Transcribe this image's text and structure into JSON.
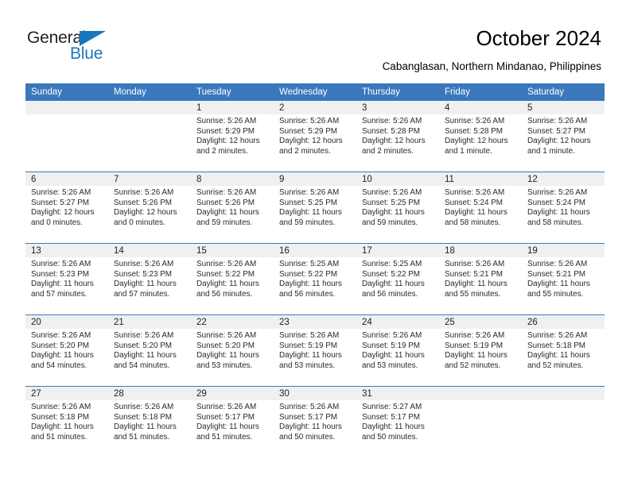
{
  "brand": {
    "name_top": "General",
    "name_bottom": "Blue",
    "accent_color": "#1878be",
    "triangle_icon": "triangle-icon"
  },
  "header": {
    "title": "October 2024",
    "subtitle": "Cabanglasan, Northern Mindanao, Philippines"
  },
  "calendar": {
    "header_color": "#3a78bd",
    "daynum_band_color": "#f0f0f0",
    "weekdays": [
      "Sunday",
      "Monday",
      "Tuesday",
      "Wednesday",
      "Thursday",
      "Friday",
      "Saturday"
    ],
    "weeks": [
      [
        {
          "day": "",
          "sunrise": "",
          "sunset": "",
          "daylight": ""
        },
        {
          "day": "",
          "sunrise": "",
          "sunset": "",
          "daylight": ""
        },
        {
          "day": "1",
          "sunrise": "Sunrise: 5:26 AM",
          "sunset": "Sunset: 5:29 PM",
          "daylight": "Daylight: 12 hours and 2 minutes."
        },
        {
          "day": "2",
          "sunrise": "Sunrise: 5:26 AM",
          "sunset": "Sunset: 5:29 PM",
          "daylight": "Daylight: 12 hours and 2 minutes."
        },
        {
          "day": "3",
          "sunrise": "Sunrise: 5:26 AM",
          "sunset": "Sunset: 5:28 PM",
          "daylight": "Daylight: 12 hours and 2 minutes."
        },
        {
          "day": "4",
          "sunrise": "Sunrise: 5:26 AM",
          "sunset": "Sunset: 5:28 PM",
          "daylight": "Daylight: 12 hours and 1 minute."
        },
        {
          "day": "5",
          "sunrise": "Sunrise: 5:26 AM",
          "sunset": "Sunset: 5:27 PM",
          "daylight": "Daylight: 12 hours and 1 minute."
        }
      ],
      [
        {
          "day": "6",
          "sunrise": "Sunrise: 5:26 AM",
          "sunset": "Sunset: 5:27 PM",
          "daylight": "Daylight: 12 hours and 0 minutes."
        },
        {
          "day": "7",
          "sunrise": "Sunrise: 5:26 AM",
          "sunset": "Sunset: 5:26 PM",
          "daylight": "Daylight: 12 hours and 0 minutes."
        },
        {
          "day": "8",
          "sunrise": "Sunrise: 5:26 AM",
          "sunset": "Sunset: 5:26 PM",
          "daylight": "Daylight: 11 hours and 59 minutes."
        },
        {
          "day": "9",
          "sunrise": "Sunrise: 5:26 AM",
          "sunset": "Sunset: 5:25 PM",
          "daylight": "Daylight: 11 hours and 59 minutes."
        },
        {
          "day": "10",
          "sunrise": "Sunrise: 5:26 AM",
          "sunset": "Sunset: 5:25 PM",
          "daylight": "Daylight: 11 hours and 59 minutes."
        },
        {
          "day": "11",
          "sunrise": "Sunrise: 5:26 AM",
          "sunset": "Sunset: 5:24 PM",
          "daylight": "Daylight: 11 hours and 58 minutes."
        },
        {
          "day": "12",
          "sunrise": "Sunrise: 5:26 AM",
          "sunset": "Sunset: 5:24 PM",
          "daylight": "Daylight: 11 hours and 58 minutes."
        }
      ],
      [
        {
          "day": "13",
          "sunrise": "Sunrise: 5:26 AM",
          "sunset": "Sunset: 5:23 PM",
          "daylight": "Daylight: 11 hours and 57 minutes."
        },
        {
          "day": "14",
          "sunrise": "Sunrise: 5:26 AM",
          "sunset": "Sunset: 5:23 PM",
          "daylight": "Daylight: 11 hours and 57 minutes."
        },
        {
          "day": "15",
          "sunrise": "Sunrise: 5:26 AM",
          "sunset": "Sunset: 5:22 PM",
          "daylight": "Daylight: 11 hours and 56 minutes."
        },
        {
          "day": "16",
          "sunrise": "Sunrise: 5:25 AM",
          "sunset": "Sunset: 5:22 PM",
          "daylight": "Daylight: 11 hours and 56 minutes."
        },
        {
          "day": "17",
          "sunrise": "Sunrise: 5:25 AM",
          "sunset": "Sunset: 5:22 PM",
          "daylight": "Daylight: 11 hours and 56 minutes."
        },
        {
          "day": "18",
          "sunrise": "Sunrise: 5:26 AM",
          "sunset": "Sunset: 5:21 PM",
          "daylight": "Daylight: 11 hours and 55 minutes."
        },
        {
          "day": "19",
          "sunrise": "Sunrise: 5:26 AM",
          "sunset": "Sunset: 5:21 PM",
          "daylight": "Daylight: 11 hours and 55 minutes."
        }
      ],
      [
        {
          "day": "20",
          "sunrise": "Sunrise: 5:26 AM",
          "sunset": "Sunset: 5:20 PM",
          "daylight": "Daylight: 11 hours and 54 minutes."
        },
        {
          "day": "21",
          "sunrise": "Sunrise: 5:26 AM",
          "sunset": "Sunset: 5:20 PM",
          "daylight": "Daylight: 11 hours and 54 minutes."
        },
        {
          "day": "22",
          "sunrise": "Sunrise: 5:26 AM",
          "sunset": "Sunset: 5:20 PM",
          "daylight": "Daylight: 11 hours and 53 minutes."
        },
        {
          "day": "23",
          "sunrise": "Sunrise: 5:26 AM",
          "sunset": "Sunset: 5:19 PM",
          "daylight": "Daylight: 11 hours and 53 minutes."
        },
        {
          "day": "24",
          "sunrise": "Sunrise: 5:26 AM",
          "sunset": "Sunset: 5:19 PM",
          "daylight": "Daylight: 11 hours and 53 minutes."
        },
        {
          "day": "25",
          "sunrise": "Sunrise: 5:26 AM",
          "sunset": "Sunset: 5:19 PM",
          "daylight": "Daylight: 11 hours and 52 minutes."
        },
        {
          "day": "26",
          "sunrise": "Sunrise: 5:26 AM",
          "sunset": "Sunset: 5:18 PM",
          "daylight": "Daylight: 11 hours and 52 minutes."
        }
      ],
      [
        {
          "day": "27",
          "sunrise": "Sunrise: 5:26 AM",
          "sunset": "Sunset: 5:18 PM",
          "daylight": "Daylight: 11 hours and 51 minutes."
        },
        {
          "day": "28",
          "sunrise": "Sunrise: 5:26 AM",
          "sunset": "Sunset: 5:18 PM",
          "daylight": "Daylight: 11 hours and 51 minutes."
        },
        {
          "day": "29",
          "sunrise": "Sunrise: 5:26 AM",
          "sunset": "Sunset: 5:17 PM",
          "daylight": "Daylight: 11 hours and 51 minutes."
        },
        {
          "day": "30",
          "sunrise": "Sunrise: 5:26 AM",
          "sunset": "Sunset: 5:17 PM",
          "daylight": "Daylight: 11 hours and 50 minutes."
        },
        {
          "day": "31",
          "sunrise": "Sunrise: 5:27 AM",
          "sunset": "Sunset: 5:17 PM",
          "daylight": "Daylight: 11 hours and 50 minutes."
        },
        {
          "day": "",
          "sunrise": "",
          "sunset": "",
          "daylight": ""
        },
        {
          "day": "",
          "sunrise": "",
          "sunset": "",
          "daylight": ""
        }
      ]
    ]
  }
}
